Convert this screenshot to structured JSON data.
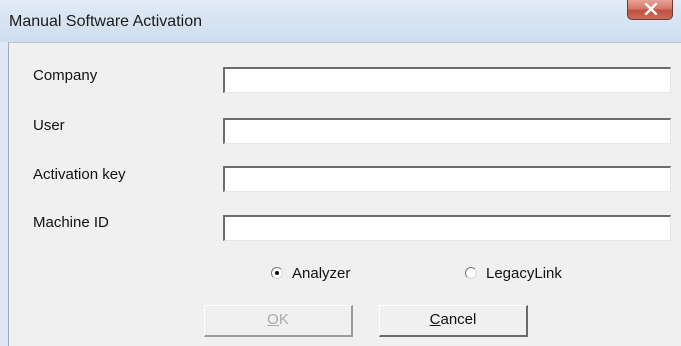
{
  "window": {
    "title": "Manual Software Activation"
  },
  "form": {
    "company_label": "Company",
    "company_value": "",
    "user_label": "User",
    "user_value": "",
    "activation_key_label": "Activation key",
    "activation_key_value": "",
    "machine_id_label": "Machine ID",
    "machine_id_value": ""
  },
  "options": {
    "analyzer_label": "Analyzer",
    "legacylink_label": "LegacyLink",
    "selected": "Analyzer"
  },
  "buttons": {
    "ok_mnemonic": "O",
    "ok_rest": "K",
    "ok_enabled": false,
    "cancel_mnemonic": "C",
    "cancel_rest": "ancel"
  },
  "icons": {
    "close": "close-icon"
  },
  "colors": {
    "close_button": "#c9604f",
    "titlebar": "#d5e2f1",
    "client_background": "#f0f0f0"
  }
}
